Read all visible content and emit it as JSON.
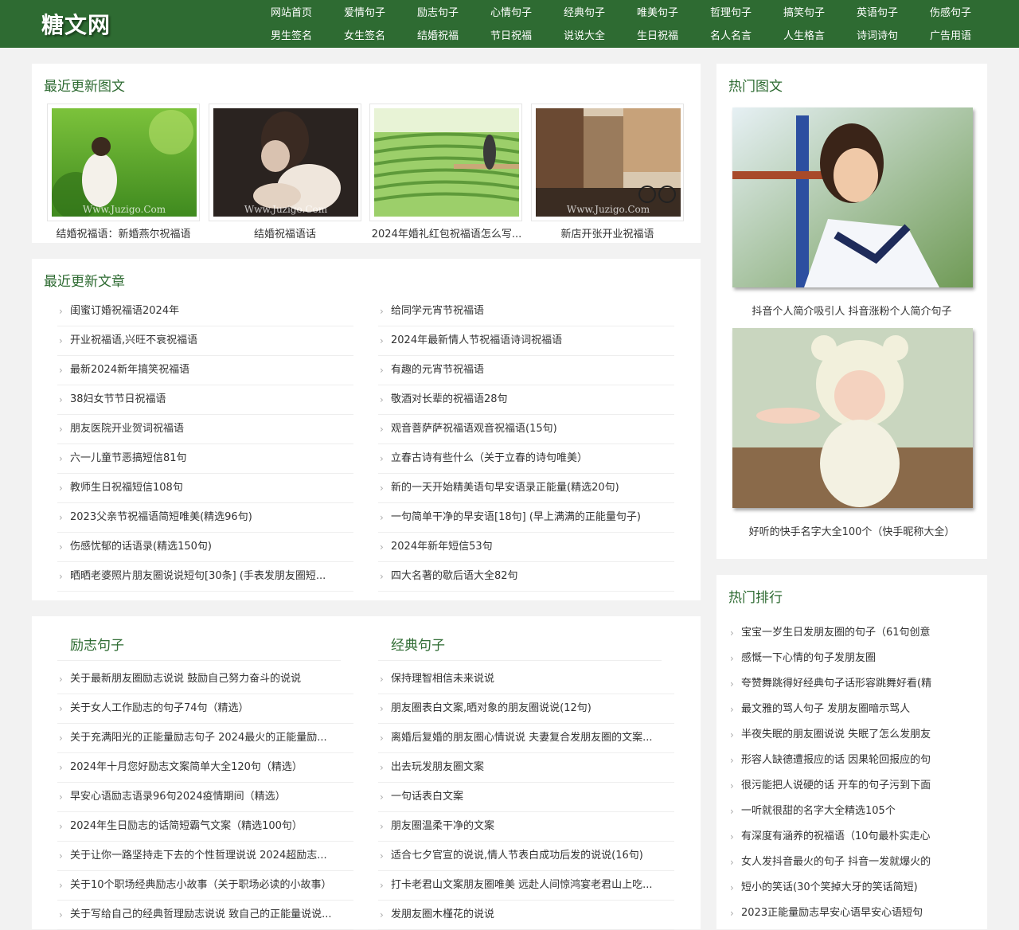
{
  "site": {
    "logo": "糖文网",
    "nav_row1": [
      "网站首页",
      "爱情句子",
      "励志句子",
      "心情句子",
      "经典句子",
      "唯美句子",
      "哲理句子",
      "搞笑句子",
      "英语句子",
      "伤感句子"
    ],
    "nav_row2": [
      "男生签名",
      "女生签名",
      "结婚祝福",
      "节日祝福",
      "说说大全",
      "生日祝福",
      "名人名言",
      "人生格言",
      "诗词诗句",
      "广告用语"
    ]
  },
  "recent_images": {
    "title": "最近更新图文",
    "watermark": "Www.Juzigo.Com",
    "items": [
      {
        "caption": "结婚祝福语：新婚燕尔祝福语"
      },
      {
        "caption": "结婚祝福语话"
      },
      {
        "caption": "2024年婚礼红包祝福语怎么写..."
      },
      {
        "caption": "新店开张开业祝福语"
      }
    ]
  },
  "recent_articles": {
    "title": "最近更新文章",
    "left": [
      "闺蜜订婚祝福语2024年",
      "开业祝福语,兴旺不衰祝福语",
      "最新2024新年搞笑祝福语",
      "38妇女节节日祝福语",
      "朋友医院开业贺词祝福语",
      "六一儿童节恶搞短信81句",
      "教师生日祝福短信108句",
      "2023父亲节祝福语简短唯美(精选96句)",
      "伤感忧郁的话语录(精选150句)",
      "晒晒老婆照片朋友圈说说短句[30条] (手表发朋友圈短..."
    ],
    "right": [
      "给同学元宵节祝福语",
      "2024年最新情人节祝福语诗词祝福语",
      "有趣的元宵节祝福语",
      "敬酒对长辈的祝福语28句",
      "观音菩萨萨祝福语观音祝福语(15句)",
      "立春古诗有些什么（关于立春的诗句唯美）",
      "新的一天开始精美语句早安语录正能量(精选20句)",
      "一句简单干净的早安语[18句] (早上满满的正能量句子)",
      "2024年新年短信53句",
      "四大名著的歇后语大全82句"
    ]
  },
  "categories": {
    "left_title": "励志句子",
    "left": [
      "关于最新朋友圈励志说说 鼓励自己努力奋斗的说说",
      "关于女人工作励志的句子74句（精选）",
      "关于充满阳光的正能量励志句子 2024最火的正能量励...",
      "2024年十月您好励志文案简单大全120句（精选）",
      "早安心语励志语录96句2024疫情期间（精选）",
      "2024年生日励志的话简短霸气文案（精选100句）",
      "关于让你一路坚持走下去的个性哲理说说 2024超励志...",
      "关于10个职场经典励志小故事（关于职场必读的小故事）",
      "关于写给自己的经典哲理励志说说 致自己的正能量说说..."
    ],
    "right_title": "经典句子",
    "right": [
      "保持理智相信未来说说",
      "朋友圈表白文案,晒对象的朋友圈说说(12句)",
      "离婚后复婚的朋友圈心情说说 夫妻复合发朋友圈的文案...",
      "出去玩发朋友圈文案",
      "一句话表白文案",
      "朋友圈温柔干净的文案",
      "适合七夕官宣的说说,情人节表白成功后发的说说(16句)",
      "打卡老君山文案朋友圈唯美 远赴人间惊鸿宴老君山上吃...",
      "发朋友圈木槿花的说说"
    ]
  },
  "hot_images": {
    "title": "热门图文",
    "items": [
      {
        "caption": "抖音个人简介吸引人 抖音涨粉个人简介句子"
      },
      {
        "caption": "好听的快手名字大全100个（快手昵称大全）"
      }
    ]
  },
  "hot_rank": {
    "title": "热门排行",
    "items": [
      "宝宝一岁生日发朋友圈的句子（61句创意",
      "感慨一下心情的句子发朋友圈",
      "夸赞舞跳得好经典句子话形容跳舞好看(精",
      "最文雅的骂人句子 发朋友圈暗示骂人",
      "半夜失眠的朋友圈说说 失眠了怎么发朋友",
      "形容人缺德遭报应的话 因果轮回报应的句",
      "很污能把人说硬的话 开车的句子污到下面",
      "一听就很甜的名字大全精选105个",
      "有深度有涵养的祝福语（10句最朴实走心",
      "女人发抖音最火的句子 抖音一发就爆火的",
      "短小的笑话(30个笑掉大牙的笑话简短)",
      "2023正能量励志早安心语早安心语短句"
    ]
  },
  "icons": {
    "list_bullet": "chevron-right-icon"
  },
  "colors": {
    "brand_green": "#2e6b32",
    "background": "#f2f2f2"
  }
}
